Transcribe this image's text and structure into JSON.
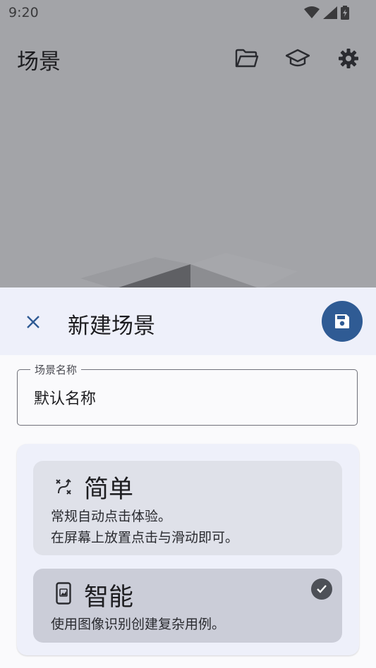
{
  "status_bar": {
    "time": "9:20"
  },
  "app_bar": {
    "title": "场景",
    "actions": [
      "folder-open-icon",
      "school-icon",
      "settings-icon"
    ]
  },
  "sheet": {
    "title": "新建场景",
    "name_field": {
      "label": "场景名称",
      "value": "默认名称"
    },
    "options": [
      {
        "title": "简单",
        "desc_line1": "常规自动点击体验。",
        "desc_line2": "在屏幕上放置点击与滑动即可。",
        "icon": "swipe-icon",
        "selected": false
      },
      {
        "title": "智能",
        "desc_line1": "使用图像识别创建复杂用例。",
        "icon": "phone-image-icon",
        "selected": true
      }
    ]
  },
  "colors": {
    "accent": "#2f5b94",
    "scrim": "#a3a4a8",
    "sheet_header": "#eef0fa"
  }
}
